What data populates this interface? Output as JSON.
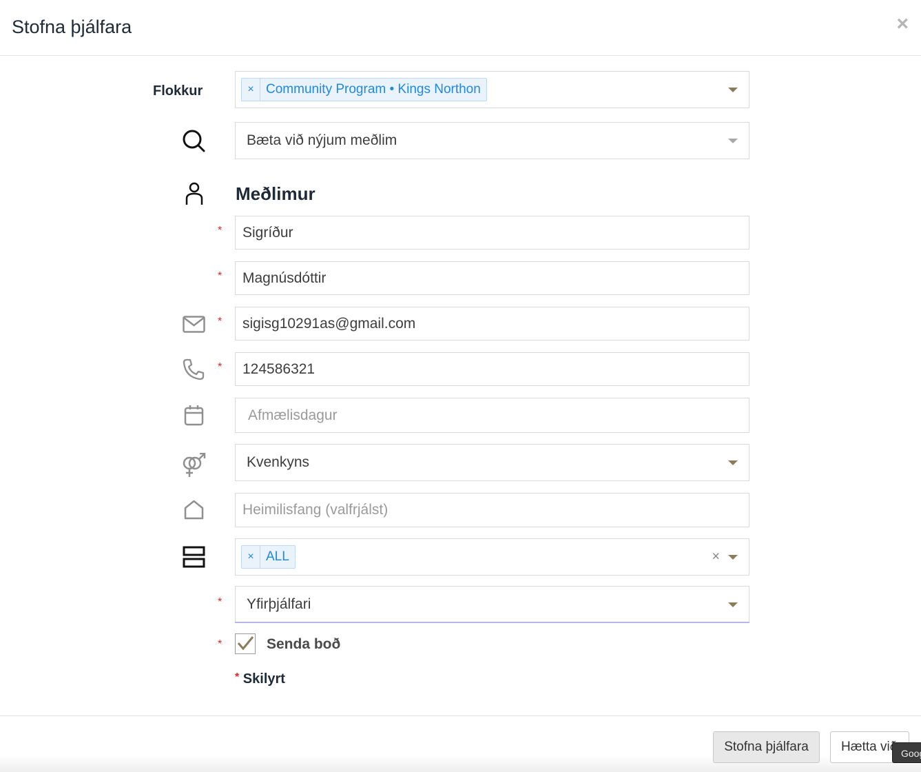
{
  "dialog": {
    "title": "Stofna þjálfara",
    "close_glyph": "×"
  },
  "form": {
    "category": {
      "label": "Flokkur",
      "tag_remove": "×",
      "tag": "Community Program • Kings Northon"
    },
    "search_member": {
      "value": "Bæta við nýjum meðlim"
    },
    "section_title": "Meðlimur",
    "required_marker": "*",
    "first_name": {
      "value": "Sigríður"
    },
    "last_name": {
      "value": "Magnúsdóttir"
    },
    "email": {
      "value": "sigisg10291as@gmail.com"
    },
    "phone": {
      "value": "124586321"
    },
    "birthday": {
      "placeholder": "Afmælisdagur"
    },
    "gender": {
      "value": "Kvenkyns"
    },
    "address": {
      "placeholder": "Heimilisfang (valfrjálst)"
    },
    "groups": {
      "tag_remove": "×",
      "tag": "ALL",
      "clear": "×"
    },
    "role": {
      "value": "Yfirþjálfari"
    },
    "send_invite": {
      "label": "Senda boð",
      "checked": true
    },
    "required_note": "Skilyrt"
  },
  "footer": {
    "create_button": "Stofna þjálfara",
    "cancel_button": "Hætta við",
    "tooltip": "Goog"
  },
  "colors": {
    "accent_caret": "#8b7d5c",
    "tag_text": "#1e88e5",
    "required": "#e02424",
    "focus_underline": "#b7b3ee"
  },
  "icons": [
    "search-icon",
    "user-icon",
    "mail-icon",
    "phone-icon",
    "calendar-icon",
    "gender-icon",
    "home-icon",
    "groups-icon",
    "check-icon"
  ]
}
